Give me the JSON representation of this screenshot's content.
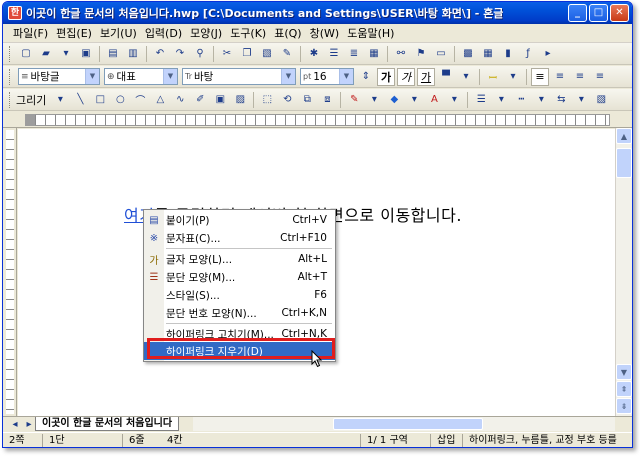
{
  "window": {
    "title": "이곳이 한글 문서의 처음입니다.hwp [C:\\Documents and Settings\\USER\\바탕 화면\\] - 혼글",
    "icon_char": "한",
    "controls": [
      "_",
      "□",
      "✕"
    ]
  },
  "menu": [
    "파일(F)",
    "편집(E)",
    "보기(U)",
    "입력(D)",
    "모양(J)",
    "도구(K)",
    "표(Q)",
    "창(W)",
    "도움말(H)"
  ],
  "toolbar_format": {
    "style": "바탕글",
    "style_prefix": "≡",
    "font_lang": "대표",
    "font": "바탕",
    "font_prefix": "Tr",
    "size": "16",
    "size_prefix": "pt",
    "buttons": [
      "가",
      "가",
      "가"
    ]
  },
  "toolbar_draw": {
    "label": "그리기"
  },
  "document": {
    "link_text": "여기",
    "rest_text": "를 클릭하면 네이버 첫 화면으로 이동합니다."
  },
  "context_menu": {
    "items": [
      {
        "icon": "▤",
        "label": "붙이기(P)",
        "shortcut": "Ctrl+V"
      },
      {
        "icon": "※",
        "label": "문자표(C)...",
        "shortcut": "Ctrl+F10"
      },
      {
        "icon": "가",
        "label": "글자 모양(L)...",
        "shortcut": "Alt+L"
      },
      {
        "icon": "☰",
        "label": "문단 모양(M)...",
        "shortcut": "Alt+T"
      },
      {
        "icon": "",
        "label": "스타일(S)...",
        "shortcut": "F6"
      },
      {
        "icon": "",
        "label": "문단 번호 모양(N)...",
        "shortcut": "Ctrl+K,N"
      },
      {
        "icon": "",
        "label": "하이퍼링크 고치기(M)...",
        "shortcut": "Ctrl+N,K"
      },
      {
        "icon": "",
        "label": "하이퍼링크 지우기(D)",
        "shortcut": ""
      }
    ],
    "selected_index": 7,
    "highlight_color": "#316ac5",
    "annotation_color": "#e01d1d"
  },
  "tab": {
    "doc_name": "이곳이 한글 문서의 처음입니다"
  },
  "status": {
    "page": "2쪽",
    "section": "1단",
    "line": "6줄",
    "column": "4칸",
    "position": "1/ 1 구역",
    "mode": "삽입",
    "message": "하이퍼링크, 누름틀, 교정 부호 등를"
  },
  "colors": {
    "titlebar": "#0054e3",
    "link": "#1f4fd6"
  }
}
